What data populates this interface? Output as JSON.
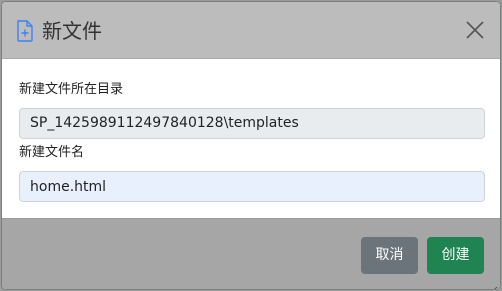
{
  "dialog": {
    "title": "新文件",
    "icon": "file-plus-icon",
    "close_icon": "close-icon"
  },
  "form": {
    "dir_label": "新建文件所在目录",
    "dir_value": "SP_1425989112497840128\\templates",
    "name_label": "新建文件名",
    "name_value": "home.html"
  },
  "footer": {
    "cancel_label": "取消",
    "create_label": "创建"
  },
  "colors": {
    "cancel": "#6b737b",
    "create": "#208352",
    "icon_accent": "#3b82f6"
  }
}
